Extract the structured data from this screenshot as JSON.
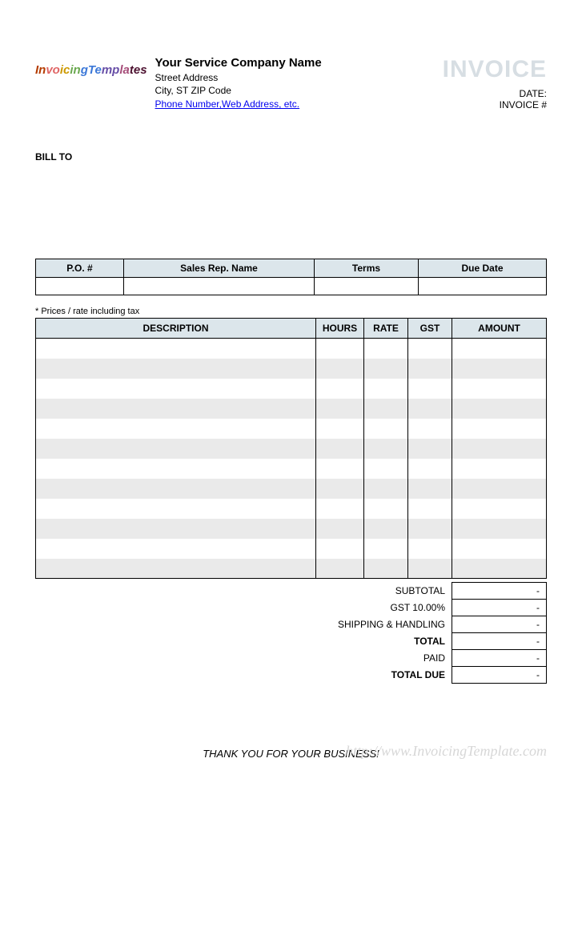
{
  "logo_text": "InvoicingTemplates",
  "company": {
    "name": "Your Service Company Name",
    "street": "Street Address",
    "city": "City, ST  ZIP Code",
    "contact_link": "Phone Number,Web Address, etc."
  },
  "doc_title": "INVOICE",
  "meta_labels": {
    "date": "DATE:",
    "invoice_no": "INVOICE #"
  },
  "bill_to_label": "BILL TO",
  "meta_headers": {
    "po": "P.O. #",
    "sales_rep": "Sales Rep. Name",
    "terms": "Terms",
    "due_date": "Due Date"
  },
  "tax_note": "* Prices / rate including tax",
  "item_headers": {
    "description": "DESCRIPTION",
    "hours": "HOURS",
    "rate": "RATE",
    "gst": "GST",
    "amount": "AMOUNT"
  },
  "totals": {
    "subtotal_label": "SUBTOTAL",
    "subtotal_val": "-",
    "gst_label": "GST  10.00%",
    "gst_val": "-",
    "shipping_label": "SHIPPING & HANDLING",
    "shipping_val": "-",
    "total_label": "TOTAL",
    "total_val": "-",
    "paid_label": "PAID",
    "paid_val": "-",
    "due_label": "TOTAL DUE",
    "due_val": "-"
  },
  "thanks": "THANK YOU FOR YOUR BUSINESS!",
  "watermark": "http://www.InvoicingTemplate.com"
}
